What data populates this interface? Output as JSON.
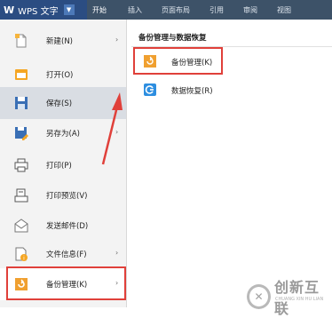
{
  "app": {
    "name": "WPS 文字"
  },
  "ribbon": {
    "tabs": [
      "开始",
      "插入",
      "页面布局",
      "引用",
      "审阅",
      "视图"
    ]
  },
  "menu": {
    "items": [
      {
        "label": "新建(N)",
        "icon": "new-doc-icon",
        "has_submenu": true
      },
      {
        "label": "打开(O)",
        "icon": "open-folder-icon",
        "has_submenu": false
      },
      {
        "label": "保存(S)",
        "icon": "save-icon",
        "has_submenu": false
      },
      {
        "label": "另存为(A)",
        "icon": "save-as-icon",
        "has_submenu": true
      },
      {
        "label": "打印(P)",
        "icon": "print-icon",
        "has_submenu": false
      },
      {
        "label": "打印预览(V)",
        "icon": "print-preview-icon",
        "has_submenu": false
      },
      {
        "label": "发送邮件(D)",
        "icon": "send-mail-icon",
        "has_submenu": false
      },
      {
        "label": "文件信息(F)",
        "icon": "file-info-icon",
        "has_submenu": true
      },
      {
        "label": "备份管理(K)",
        "icon": "backup-icon",
        "has_submenu": true
      }
    ]
  },
  "submenu": {
    "title": "备份管理与数据恢复",
    "items": [
      {
        "label": "备份管理(K)",
        "icon": "backup-icon"
      },
      {
        "label": "数据恢复(R)",
        "icon": "data-recovery-icon"
      }
    ]
  },
  "watermark": {
    "text": "创新互联",
    "sub": "CHUANG XIN HU LIAN"
  },
  "colors": {
    "highlight": "#e0403a",
    "topbar": "#3d5268",
    "app_button": "#2b4d82"
  }
}
